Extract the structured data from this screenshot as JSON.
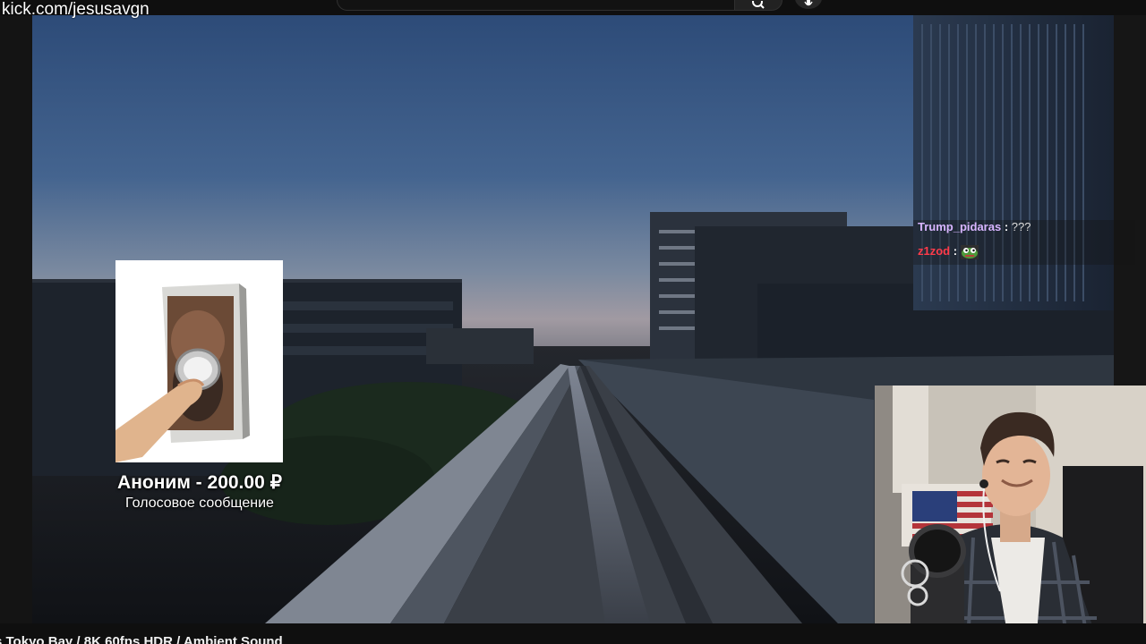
{
  "browser": {
    "url_overlay": "kick.com/jesusavgn"
  },
  "header": {
    "search_icon": "search-icon",
    "mic_icon": "mic-icon"
  },
  "video": {
    "title": "s Tokyo Bay / 8K 60fps HDR / Ambient Sound"
  },
  "donation_alert": {
    "title": "Аноним - 200.00 ₽",
    "subtitle": "Голосовое сообщение"
  },
  "chat": {
    "messages": [
      {
        "user": "Trump_pidaras",
        "separator": ":",
        "text": "???"
      },
      {
        "user": "z1zod",
        "separator": ":",
        "emote": "pepe-emote"
      }
    ]
  },
  "colors": {
    "background": "#0f0f0f",
    "chat_user_1": "#d8b5ff",
    "chat_user_2": "#ff3b4a",
    "sky_top": "#2e4f7d",
    "sky_horizon": "#8a96a4"
  }
}
